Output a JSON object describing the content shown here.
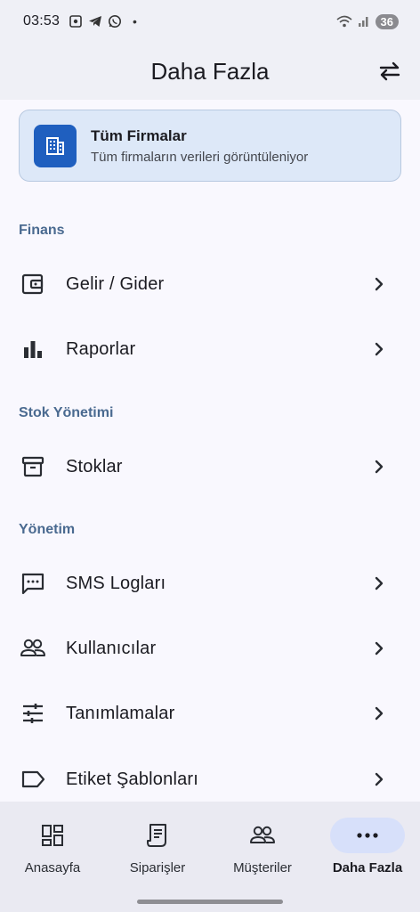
{
  "status_bar": {
    "time": "03:53",
    "battery": "36",
    "dot": "•"
  },
  "app_bar": {
    "title": "Daha Fazla"
  },
  "firm_card": {
    "title": "Tüm Firmalar",
    "subtitle": "Tüm firmaların verileri görüntüleniyor"
  },
  "sections": [
    {
      "title": "Finans"
    },
    {
      "title": "Stok Yönetimi"
    },
    {
      "title": "Yönetim"
    }
  ],
  "menu": [
    {
      "label": "Gelir / Gider",
      "icon": "wallet-icon"
    },
    {
      "label": "Raporlar",
      "icon": "bar-chart-icon"
    },
    {
      "label": "Stoklar",
      "icon": "archive-icon"
    },
    {
      "label": "SMS Logları",
      "icon": "message-icon"
    },
    {
      "label": "Kullanıcılar",
      "icon": "users-icon"
    },
    {
      "label": "Tanımlamalar",
      "icon": "sliders-icon"
    },
    {
      "label": "Etiket Şablonları",
      "icon": "label-icon"
    }
  ],
  "bottom_nav": [
    {
      "label": "Anasayfa",
      "icon": "dashboard-icon"
    },
    {
      "label": "Siparişler",
      "icon": "receipt-icon"
    },
    {
      "label": "Müşteriler",
      "icon": "users-icon"
    },
    {
      "label": "Daha Fazla",
      "icon": "more-horizontal-icon",
      "active": true
    }
  ],
  "colors": {
    "accent": "#1f5fbf",
    "section_header": "#4a6a90",
    "card_bg": "#dde8f8",
    "active_pill": "#d7e0fa"
  }
}
